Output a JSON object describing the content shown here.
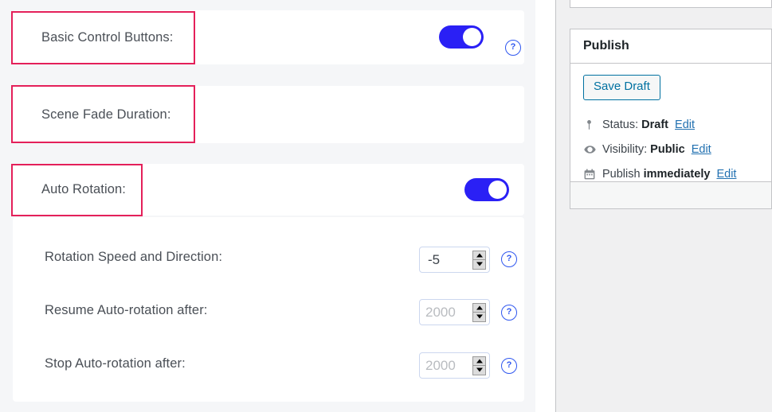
{
  "colors": {
    "accent_toggle": "#2a20f5",
    "annotation_box": "#e4205a",
    "help_icon": "#2f57ef",
    "wp_link": "#2271b1",
    "wp_button_border": "#0071a1",
    "panel_bg": "#f5f6f8",
    "rail_bg": "#f0f0f1"
  },
  "settings": {
    "rows": [
      {
        "label": "Basic Control Buttons:",
        "control": "toggle",
        "toggle_on": true,
        "help_icon": "question-mark-circle-icon",
        "annotated": true
      },
      {
        "label": "Scene Fade Duration:",
        "control": "number",
        "value": "",
        "placeholder": "",
        "help_icon": "question-mark-circle-icon",
        "annotated": true
      },
      {
        "label": "Auto Rotation:",
        "control": "toggle",
        "toggle_on": true,
        "help_icon": "",
        "annotated": true
      }
    ],
    "sub_rows": [
      {
        "label": "Rotation Speed and Direction:",
        "control": "number",
        "value": "-5",
        "placeholder": "",
        "help_icon": "question-mark-circle-icon"
      },
      {
        "label": "Resume Auto-rotation after:",
        "control": "number",
        "value": "",
        "placeholder": "2000",
        "help_icon": "question-mark-circle-icon"
      },
      {
        "label": "Stop Auto-rotation after:",
        "control": "number",
        "value": "",
        "placeholder": "2000",
        "help_icon": "question-mark-circle-icon"
      }
    ],
    "help_glyph": "?"
  },
  "publish": {
    "title": "Publish",
    "save_draft_label": "Save Draft",
    "status": {
      "icon": "pin-icon",
      "prefix": "Status:",
      "value": "Draft",
      "edit_label": "Edit"
    },
    "visibility": {
      "icon": "eye-icon",
      "prefix": "Visibility:",
      "value": "Public",
      "edit_label": "Edit"
    },
    "schedule": {
      "icon": "calendar-icon",
      "prefix": "Publish",
      "value": "immediately",
      "edit_label": "Edit"
    }
  }
}
